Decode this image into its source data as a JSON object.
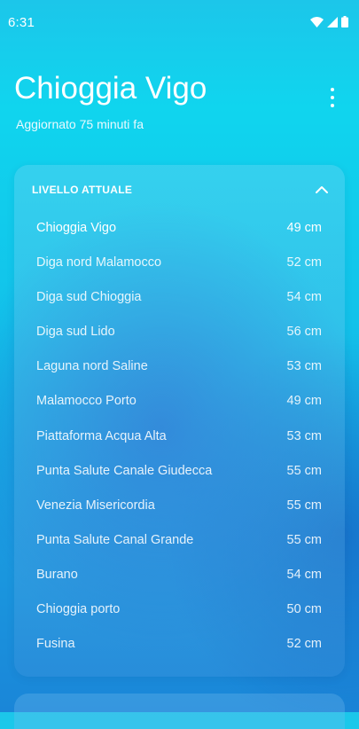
{
  "status_bar": {
    "time": "6:31",
    "icons": [
      "wifi-icon",
      "signal-icon",
      "battery-icon"
    ]
  },
  "header": {
    "title": "Chioggia Vigo",
    "subtitle": "Aggiornato 75 minuti fa",
    "menu_icon": "more-vertical-icon"
  },
  "card": {
    "heading": "LIVELLO ATTUALE",
    "collapse_icon": "chevron-up-icon",
    "stations": [
      {
        "name": "Chioggia Vigo",
        "level": "49 cm"
      },
      {
        "name": "Diga nord Malamocco",
        "level": "52 cm"
      },
      {
        "name": "Diga sud Chioggia",
        "level": "54 cm"
      },
      {
        "name": "Diga sud Lido",
        "level": "56 cm"
      },
      {
        "name": "Laguna nord Saline",
        "level": "53 cm"
      },
      {
        "name": "Malamocco Porto",
        "level": "49 cm"
      },
      {
        "name": "Piattaforma Acqua Alta",
        "level": "53 cm"
      },
      {
        "name": "Punta Salute Canale Giudecca",
        "level": "55 cm"
      },
      {
        "name": "Venezia Misericordia",
        "level": "55 cm"
      },
      {
        "name": "Punta Salute Canal Grande",
        "level": "55 cm"
      },
      {
        "name": "Burano",
        "level": "54 cm"
      },
      {
        "name": "Chioggia porto",
        "level": "50 cm"
      },
      {
        "name": "Fusina",
        "level": "52 cm"
      }
    ]
  },
  "colors": {
    "background_top": "#10d5ee",
    "background_bottom": "#1a86d8",
    "text": "#ffffff"
  }
}
